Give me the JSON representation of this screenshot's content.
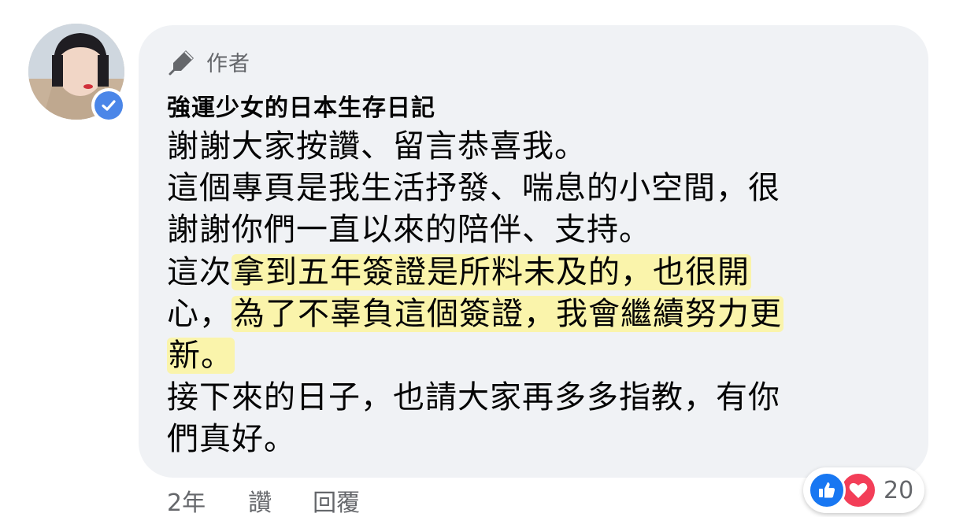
{
  "comment": {
    "author_tag": "作者",
    "commenter_name": "強運少女的日本生存日記",
    "lines": [
      [
        "謝謝大家按讚、留言恭喜我。"
      ],
      [
        "這個專頁是我生活抒發、喘息的小空間，很"
      ],
      [
        "謝謝你們一直以來的陪伴、支持。"
      ],
      [
        "這次",
        "拿到五年簽證是所料未及的，也很開"
      ],
      [
        "心，",
        "為了不辜負這個簽證，我會繼續努力更"
      ],
      [
        "新。"
      ],
      [
        "接下來的日子，也請大家再多多指教，有你"
      ],
      [
        "們真好。"
      ]
    ]
  },
  "footer": {
    "time": "2年",
    "like_label": "讚",
    "reply_label": "回覆"
  },
  "reactions": {
    "count": "20",
    "icons": [
      "like-icon",
      "love-icon"
    ]
  },
  "colors": {
    "bubble": "#f0f2f5",
    "text": "#050505",
    "secondary_text": "#65676b",
    "like_blue": "#1877f2",
    "love_red": "#f33e58",
    "verified_blue": "#4b86e8",
    "highlight": "#fff582"
  }
}
